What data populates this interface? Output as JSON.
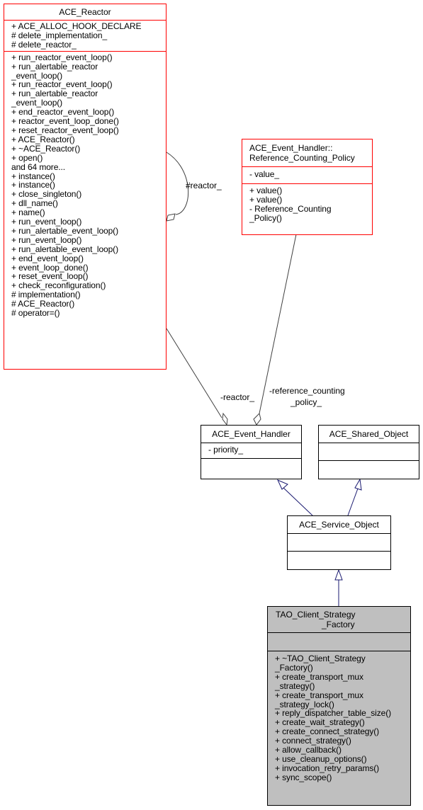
{
  "classes": {
    "ace_reactor": {
      "name": "ACE_Reactor",
      "attributes": [
        "+ ACE_ALLOC_HOOK_DECLARE",
        "# delete_implementation_",
        "# delete_reactor_"
      ],
      "methods": [
        "+ run_reactor_event_loop()",
        "+ run_alertable_reactor",
        "_event_loop()",
        "+ run_reactor_event_loop()",
        "+ run_alertable_reactor",
        "_event_loop()",
        "+ end_reactor_event_loop()",
        "+ reactor_event_loop_done()",
        "+ reset_reactor_event_loop()",
        "+ ACE_Reactor()",
        "+ ~ACE_Reactor()",
        "+ open()",
        "and 64 more...",
        "+ instance()",
        "+ instance()",
        "+ close_singleton()",
        "+ dll_name()",
        "+ name()",
        "+ run_event_loop()",
        "+ run_alertable_event_loop()",
        "+ run_event_loop()",
        "+ run_alertable_event_loop()",
        "+ end_event_loop()",
        "+ event_loop_done()",
        "+ reset_event_loop()",
        "+ check_reconfiguration()",
        "# implementation()",
        "# ACE_Reactor()",
        "# operator=()"
      ]
    },
    "ref_counting_policy": {
      "name_lines": [
        "ACE_Event_Handler::",
        "Reference_Counting_Policy"
      ],
      "attributes": [
        "- value_"
      ],
      "methods": [
        "+ value()",
        "+ value()",
        "- Reference_Counting",
        "_Policy()"
      ]
    },
    "ace_event_handler": {
      "name": "ACE_Event_Handler",
      "attributes": [
        "- priority_"
      ],
      "methods": []
    },
    "ace_shared_object": {
      "name": "ACE_Shared_Object",
      "attributes": [],
      "methods": []
    },
    "ace_service_object": {
      "name": "ACE_Service_Object",
      "attributes": [],
      "methods": []
    },
    "tao_client_strategy_factory": {
      "name_lines": [
        "TAO_Client_Strategy",
        "_Factory"
      ],
      "attributes": [],
      "methods": [
        "+ ~TAO_Client_Strategy",
        "_Factory()",
        "+ create_transport_mux",
        "_strategy()",
        "+ create_transport_mux",
        "_strategy_lock()",
        "+ reply_dispatcher_table_size()",
        "+ create_wait_strategy()",
        "+ create_connect_strategy()",
        "+ connect_strategy()",
        "+ allow_callback()",
        "+ use_cleanup_options()",
        "+ invocation_retry_params()",
        "+ sync_scope()"
      ]
    }
  },
  "edge_labels": {
    "self_reactor": "#reactor_",
    "reactor": "-reactor_",
    "ref_policy_1": "-reference_counting",
    "ref_policy_2": "_policy_"
  },
  "colors": {
    "incomplete_border": "#ff0000",
    "normal_border": "#000000",
    "focus_fill": "#bfbfbf",
    "inheritance_edge": "#191970",
    "usage_edge": "#404040"
  }
}
